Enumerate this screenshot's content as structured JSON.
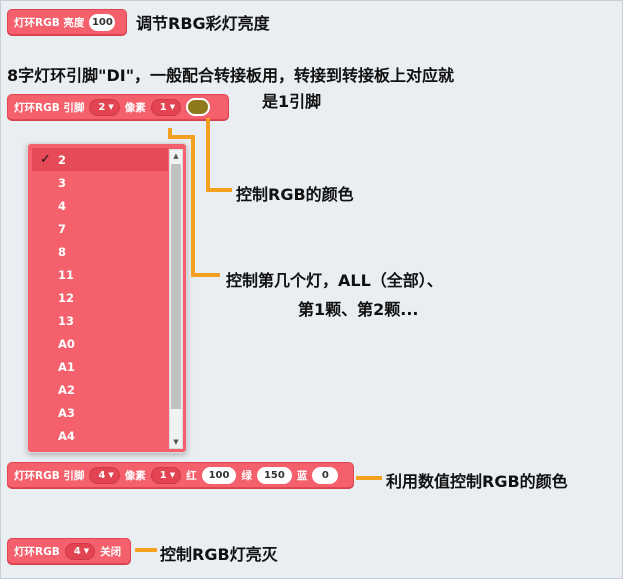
{
  "blocks": {
    "brightness": {
      "label": "灯环RGB 亮度",
      "value": "100"
    },
    "pin_pixel": {
      "label1": "灯环RGB 引脚",
      "pin": "2",
      "label2": "像素",
      "pixel": "1"
    },
    "rgb": {
      "label1": "灯环RGB 引脚",
      "pin": "4",
      "label2": "像素",
      "pixel": "1",
      "r_label": "红",
      "r": "100",
      "g_label": "绿",
      "g": "150",
      "b_label": "蓝",
      "b": "0"
    },
    "toggle": {
      "label": "灯环RGB",
      "pin": "4",
      "state": "关闭"
    }
  },
  "swatch_color": "#8e7a1c",
  "accent_color": "#f4606c",
  "arrow_color": "#f5a01f",
  "notes": {
    "brightness": "调节RBG彩灯亮度",
    "pin_line1": "8字灯环引脚\"DI\"，一般配合转接板用，转接到转接板上对应就",
    "pin_line2": "是1引脚",
    "color": "控制RGB的颜色",
    "which_line1": "控制第几个灯，ALL（全部）、",
    "which_line2": "第1颗、第2颗...",
    "rgb": "利用数值控制RGB的颜色",
    "toggle": "控制RGB灯亮灭"
  },
  "dropdown": {
    "selected": "2",
    "items": [
      "2",
      "3",
      "4",
      "7",
      "8",
      "11",
      "12",
      "13",
      "A0",
      "A1",
      "A2",
      "A3",
      "A4"
    ]
  }
}
